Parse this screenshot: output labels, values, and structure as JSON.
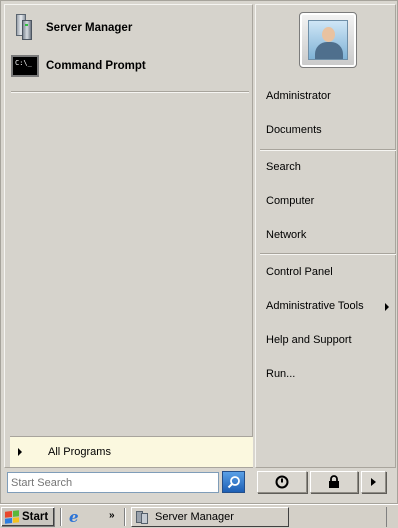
{
  "pinned": [
    {
      "label": "Server Manager",
      "icon": "server-manager-icon"
    },
    {
      "label": "Command Prompt",
      "icon": "command-prompt-icon",
      "icon_text": "C:\\_"
    }
  ],
  "all_programs": {
    "label": "All Programs"
  },
  "right_pane": {
    "user_picture": "user-avatar-icon",
    "items": [
      {
        "label": "Administrator"
      },
      {
        "label": "Documents"
      },
      {
        "label": "Search"
      },
      {
        "label": "Computer"
      },
      {
        "label": "Network"
      },
      {
        "label": "Control Panel"
      },
      {
        "label": "Administrative Tools",
        "has_submenu": true
      },
      {
        "label": "Help and Support"
      },
      {
        "label": "Run..."
      }
    ]
  },
  "search": {
    "placeholder": "Start Search"
  },
  "bottom_buttons": [
    {
      "icon": "power-icon"
    },
    {
      "icon": "lock-icon"
    },
    {
      "icon": "arrow-right-icon"
    }
  ],
  "taskbar": {
    "start_label": "Start",
    "quick_launch": [
      "internet-explorer-icon"
    ],
    "overflow": "»",
    "tasks": [
      {
        "label": "Server Manager",
        "icon": "server-manager-icon"
      }
    ]
  },
  "colors": {
    "menu_bg": "#d6d3cc",
    "all_programs_bg": "#fbf8df",
    "search_button": "#1d5fb5"
  }
}
